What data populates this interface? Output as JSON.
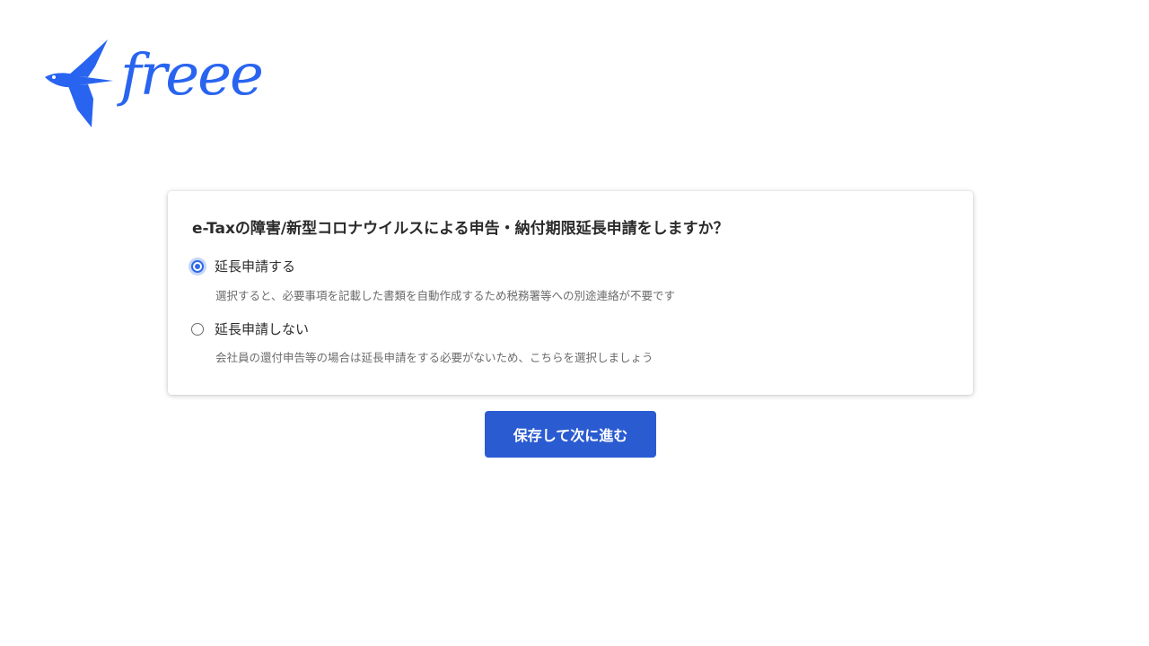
{
  "brand": {
    "logo_text": "freee",
    "color": "#2864f0"
  },
  "form": {
    "question": "e-Taxの障害/新型コロナウイルスによる申告・納付期限延長申請をしますか？",
    "options": [
      {
        "label": "延長申請する",
        "description": "選択すると、必要事項を記載した書類を自動作成するため税務署等への別途連絡が不要です",
        "selected": true
      },
      {
        "label": "延長申請しない",
        "description": "会社員の還付申告等の場合は延長申請をする必要がないため、こちらを選択しましょう",
        "selected": false
      }
    ],
    "accent_color": "#2f6ae6"
  },
  "actions": {
    "submit_label": "保存して次に進む",
    "submit_color": "#2a5bd1"
  }
}
